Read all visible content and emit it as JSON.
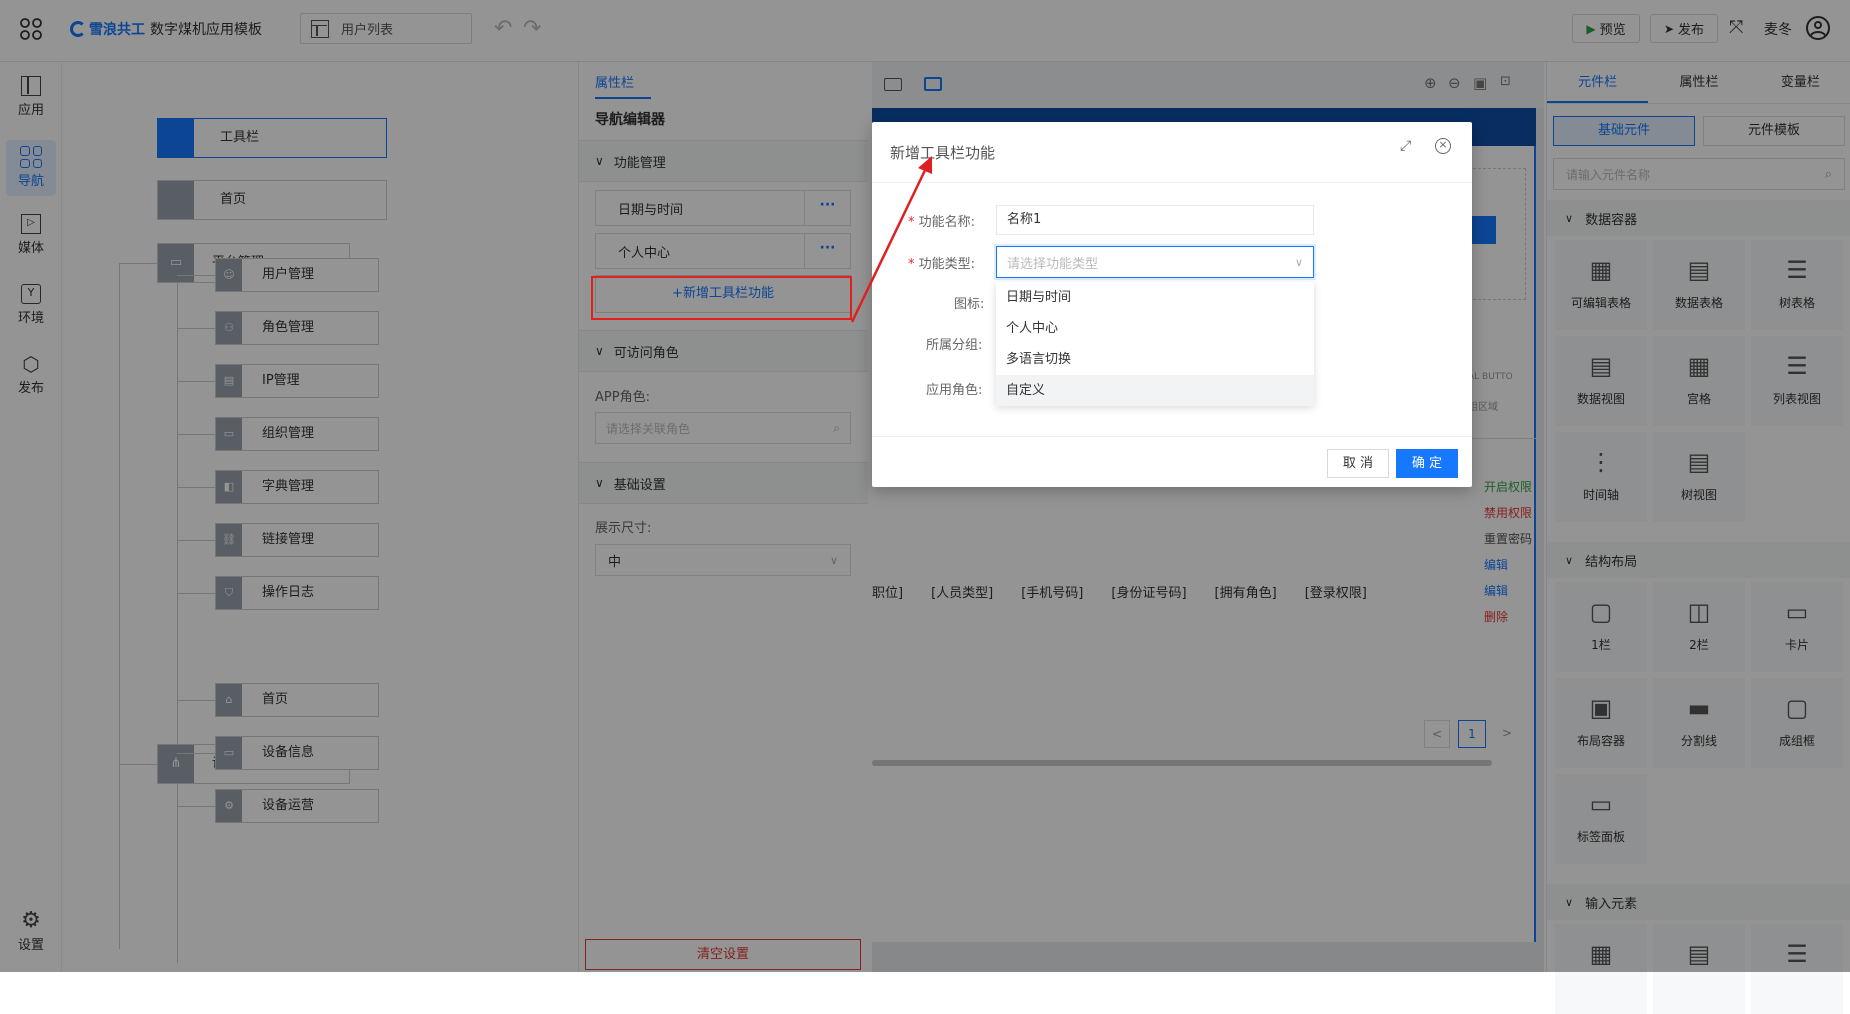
{
  "header": {
    "brand": "雪浪共工",
    "app_title": "数字煤机应用模板",
    "page_select": "用户列表",
    "preview_label": "预览",
    "publish_label": "发布",
    "user_name": "麦冬"
  },
  "left_nav": {
    "items": [
      {
        "label": "应用",
        "icon": "layout-icon"
      },
      {
        "label": "导航",
        "icon": "grid-icon"
      },
      {
        "label": "媒体",
        "icon": "media-icon"
      },
      {
        "label": "环境",
        "icon": "env-icon"
      },
      {
        "label": "发布",
        "icon": "cube-icon"
      }
    ],
    "settings_label": "设置"
  },
  "nav_tree": {
    "toolbar": "工具栏",
    "home": "首页",
    "platform": "平台管理",
    "platform_children": [
      "用户管理",
      "角色管理",
      "IP管理",
      "组织管理",
      "字典管理",
      "链接管理",
      "操作日志"
    ],
    "device": "设备管理",
    "device_children": [
      "首页",
      "设备信息",
      "设备运营"
    ]
  },
  "props": {
    "tab": "属性栏",
    "title": "导航编辑器",
    "section_func": "功能管理",
    "func_items": [
      "日期与时间",
      "个人中心"
    ],
    "add_btn": "+新增工具栏功能",
    "section_role": "可访问角色",
    "app_role_label": "APP角色:",
    "role_placeholder": "请选择关联角色",
    "section_basic": "基础设置",
    "size_label": "展示尺寸:",
    "size_value": "中",
    "clear_btn": "清空设置"
  },
  "canvas": {
    "columns": [
      "职位]",
      "[人员类型]",
      "[手机号码]",
      "[身份证号码]",
      "[拥有角色]",
      "[登录权限]"
    ],
    "actions": [
      {
        "label": "开启权限",
        "color": "#36a34a"
      },
      {
        "label": "禁用权限",
        "color": "#e53935"
      },
      {
        "label": "重置密码",
        "color": "#555555"
      },
      {
        "label": "编辑",
        "color": "#1677ff"
      },
      {
        "label": "编辑",
        "color": "#1677ff"
      },
      {
        "label": "删除",
        "color": "#e53935"
      }
    ],
    "side_snips": [
      "AL BUTTO",
      "组区域"
    ],
    "page_num": "1"
  },
  "right_panel": {
    "tabs": [
      "元件栏",
      "属性栏",
      "变量栏"
    ],
    "sub_tabs": [
      "基础元件",
      "元件模板"
    ],
    "search_placeholder": "请输入元件名称",
    "sections": [
      {
        "title": "数据容器",
        "items": [
          "可编辑表格",
          "数据表格",
          "树表格",
          "数据视图",
          "宫格",
          "列表视图",
          "时间轴",
          "树视图"
        ]
      },
      {
        "title": "结构布局",
        "items": [
          "1栏",
          "2栏",
          "卡片",
          "布局容器",
          "分割线",
          "成组框",
          "标签面板"
        ]
      },
      {
        "title": "输入元素",
        "items": []
      }
    ]
  },
  "dialog": {
    "title": "新增工具栏功能",
    "name_label": "功能名称:",
    "name_value": "名称1",
    "type_label": "功能类型:",
    "type_placeholder": "请选择功能类型",
    "icon_label": "图标:",
    "group_label": "所属分组:",
    "role_label": "应用角色:",
    "options": [
      "日期与时间",
      "个人中心",
      "多语言切换",
      "自定义"
    ],
    "cancel_label": "取 消",
    "ok_label": "确 定"
  },
  "colors": {
    "accent": "#1677ff",
    "annotation_red": "#e02020",
    "required": "#f5222d"
  }
}
